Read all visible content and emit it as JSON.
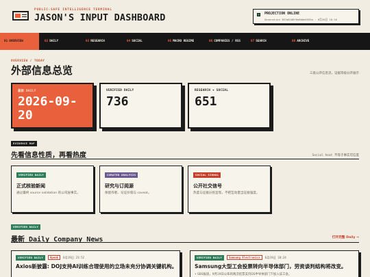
{
  "header": {
    "eyebrow": "PUBLIC-SAFE INTELLIGENCE TERMINAL",
    "title": "JASON'S INPUT DASHBOARD",
    "status_title": "PROJECTION ONLINE",
    "status_meta": "Generation 387a8108f0e8b8e6555a · 6月20日 18:10"
  },
  "nav": [
    {
      "num": "01",
      "label": "OVERVIEW",
      "active": true
    },
    {
      "num": "02",
      "label": "DAILY"
    },
    {
      "num": "03",
      "label": "RESEARCH"
    },
    {
      "num": "04",
      "label": "SOCIAL"
    },
    {
      "num": "05",
      "label": "MACRO REGIME"
    },
    {
      "num": "06",
      "label": "COMPANIES / RSS"
    },
    {
      "num": "07",
      "label": "SEARCH"
    },
    {
      "num": "08",
      "label": "ARCHIVE"
    }
  ],
  "overview": {
    "eyebrow": "OVERVIEW / TODAY",
    "title": "外部信息总览",
    "note": "三类公开信息流，证据等级分开展示",
    "stats": [
      {
        "label": "最新 DAILY",
        "value": "2026-09-20"
      },
      {
        "label": "VERIFIED DAILY",
        "value": "736"
      },
      {
        "label": "RESEARCH + SOCIAL",
        "value": "651"
      }
    ]
  },
  "evidence": {
    "tag": "EVIDENCE MAP",
    "title": "先看信息性质，再看热度",
    "note": "Social heat 不等于事实可信度",
    "cards": [
      {
        "tag": "VERIFIED DAILY",
        "title": "正式核验新闻",
        "desc": "通过最终 source validation 的公司层事实。"
      },
      {
        "tag": "CURATED ANALYSIS",
        "title": "研究与订阅源",
        "desc": "保留作者、论证价值与 caveat。"
      },
      {
        "tag": "SOCIAL SIGNAL",
        "title": "公开社交信号",
        "desc": "热度与证据分别呈现，不把互动量当证据强度。"
      }
    ]
  },
  "daily": {
    "tag": "VERIFIED DAILY",
    "title": "最新 Daily Company News",
    "link": "打开完整 Daily →",
    "items": [
      {
        "tag": "VERIFIED DAILY",
        "source": "Apeak",
        "time": "6月19日 23:52",
        "headline": "Axios新披露: DOJ支持AI训练合理使用的立场未充分协调关键机构。",
        "body": ""
      },
      {
        "tag": "VERIFIED DAILY",
        "source": "Samsung Electronics",
        "time": "6月19日 18:24",
        "headline": "Samsung大型工会投票转向半导体部门，劳资谈判结构将改变。",
        "body": "• SBS报道，9月19日公布的两次结票支持DS半导体部门下加入该工会。"
      }
    ]
  },
  "colors": {
    "accent": "#e8613c",
    "ink": "#1c1c1c",
    "paper": "#f1ede2",
    "verified": "#2f7d5a",
    "curated": "#6b5a8f",
    "social": "#c4402a"
  }
}
